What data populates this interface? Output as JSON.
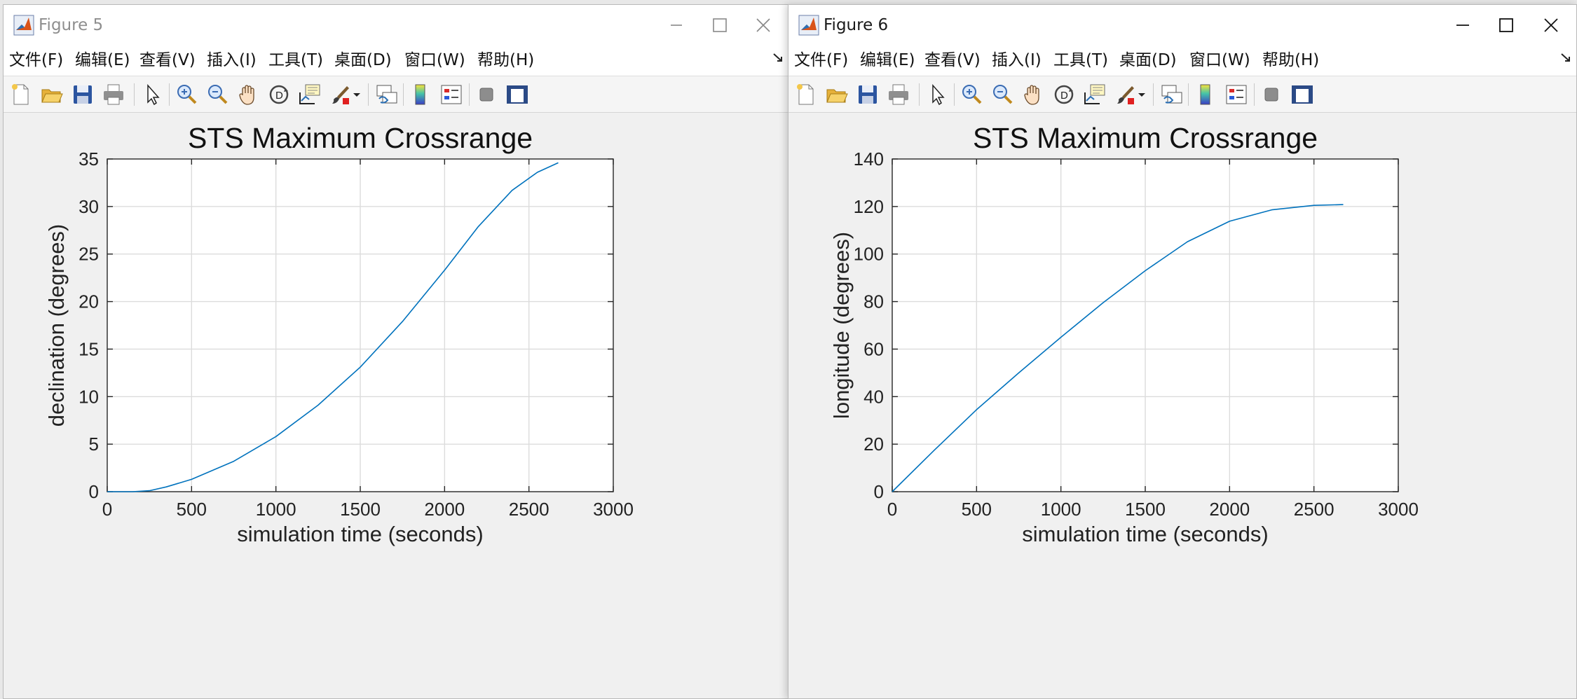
{
  "windows": [
    {
      "id": "win5",
      "title": "Figure 5",
      "menu": [
        "文件(F)",
        "编辑(E)",
        "查看(V)",
        "插入(I)",
        "工具(T)",
        "桌面(D)",
        "窗口(W)",
        "帮助(H)"
      ],
      "chart_data": {
        "type": "line",
        "title": "STS Maximum Crossrange",
        "xlabel": "simulation time (seconds)",
        "ylabel": "declination (degrees)",
        "xlim": [
          0,
          3000
        ],
        "ylim": [
          0,
          35
        ],
        "xticks": [
          0,
          500,
          1000,
          1500,
          2000,
          2500,
          3000
        ],
        "yticks": [
          0,
          5,
          10,
          15,
          20,
          25,
          30,
          35
        ],
        "grid": true,
        "line_color": "#0072BD",
        "series": [
          {
            "x": [
              0,
              150,
              250,
              350,
              500,
              750,
              1000,
              1250,
              1500,
              1750,
              2000,
              2200,
              2400,
              2550,
              2674
            ],
            "y": [
              0,
              0,
              0.1,
              0.5,
              1.3,
              3.2,
              5.8,
              9.1,
              13.1,
              17.9,
              23.3,
              27.9,
              31.7,
              33.6,
              34.6
            ]
          }
        ]
      }
    },
    {
      "id": "win6",
      "title": "Figure 6",
      "menu": [
        "文件(F)",
        "编辑(E)",
        "查看(V)",
        "插入(I)",
        "工具(T)",
        "桌面(D)",
        "窗口(W)",
        "帮助(H)"
      ],
      "chart_data": {
        "type": "line",
        "title": "STS Maximum Crossrange",
        "xlabel": "simulation time (seconds)",
        "ylabel": "longitude (degrees)",
        "xlim": [
          0,
          3000
        ],
        "ylim": [
          0,
          140
        ],
        "xticks": [
          0,
          500,
          1000,
          1500,
          2000,
          2500,
          3000
        ],
        "yticks": [
          0,
          20,
          40,
          60,
          80,
          100,
          120,
          140
        ],
        "grid": true,
        "line_color": "#0072BD",
        "series": [
          {
            "x": [
              0,
              250,
              500,
              750,
              1000,
              1250,
              1500,
              1750,
              2000,
              2250,
              2500,
              2674
            ],
            "y": [
              0,
              17.5,
              34.5,
              50,
              65,
              79.5,
              93,
              105.2,
              113.8,
              118.6,
              120.5,
              120.8
            ]
          }
        ]
      }
    }
  ],
  "toolbar_icons": [
    "new-figure-icon",
    "open-file-icon",
    "save-icon",
    "print-icon",
    "edit-plot-icon",
    "zoom-in-icon",
    "zoom-out-icon",
    "pan-icon",
    "rotate-3d-icon",
    "data-cursor-icon",
    "brush-icon",
    "brush-dropdown-icon",
    "link-plot-icon",
    "colorbar-icon",
    "legend-icon",
    "hide-plot-tools-icon",
    "show-plot-tools-icon"
  ],
  "colors": {
    "plot_line": "#0072BD",
    "matlab_logo": "#d95319"
  }
}
